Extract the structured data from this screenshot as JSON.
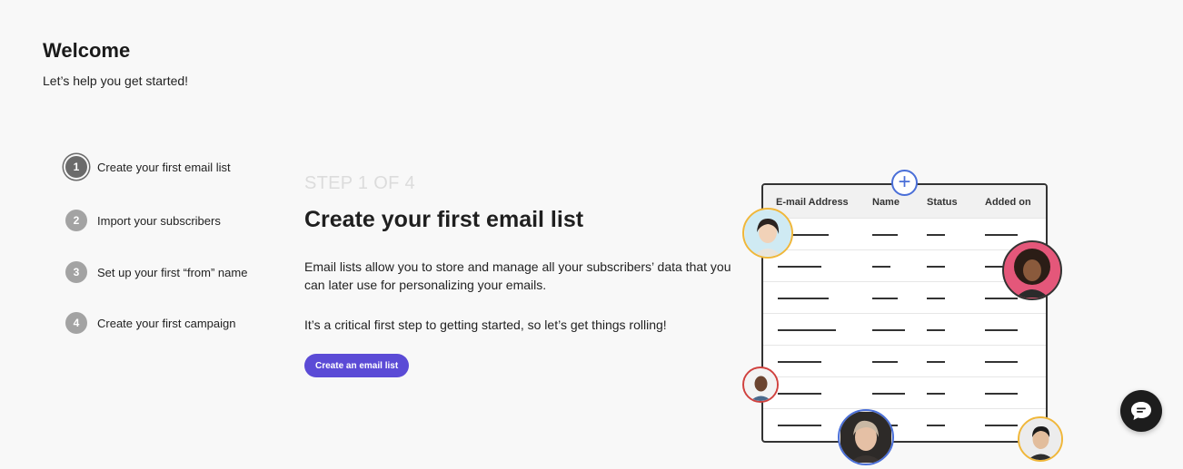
{
  "header": {
    "title": "Welcome",
    "subtitle": "Let’s help you get started!"
  },
  "steps": [
    {
      "num": "1",
      "label": "Create your first email list",
      "active": true
    },
    {
      "num": "2",
      "label": "Import your subscribers",
      "active": false
    },
    {
      "num": "3",
      "label": "Set up your first “from” name",
      "active": false
    },
    {
      "num": "4",
      "label": "Create your first campaign",
      "active": false
    }
  ],
  "content": {
    "kicker": "STEP 1 OF 4",
    "title": "Create your first email list",
    "paragraph1": "Email lists allow you to store and manage all your subscribers’ data that you can later use for personalizing your emails.",
    "paragraph2": "It’s a critical first step to getting started, so let’s get things rolling!",
    "cta_label": "Create an email list"
  },
  "illustration": {
    "columns": [
      "E-mail Address",
      "Name",
      "Status",
      "Added on"
    ],
    "plus_symbol": "+",
    "colors": {
      "accent": "#5b4bd6",
      "plus": "#4a6fd8",
      "ring_yellow": "#f0b73a",
      "ring_red": "#d0423f",
      "ring_dark": "#333333",
      "ring_blue": "#4a6fd8"
    }
  },
  "chat": {
    "icon": "chat-bubble-icon"
  }
}
